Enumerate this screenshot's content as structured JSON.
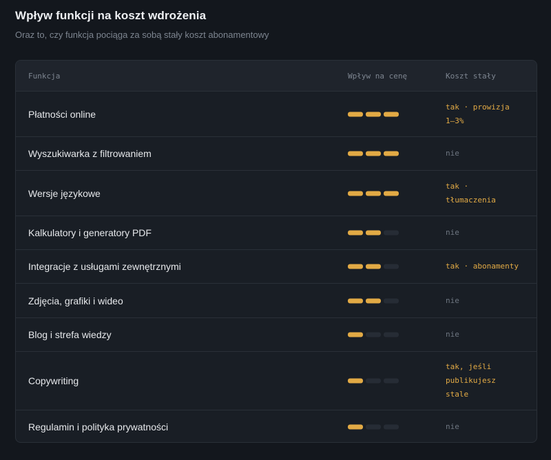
{
  "title": "Wpływ funkcji na koszt wdrożenia",
  "subtitle": "Oraz to, czy funkcja pociąga za sobą stały koszt abonamentowy",
  "table": {
    "headers": {
      "feature": "Funkcja",
      "impact": "Wpływ na cenę",
      "cost": "Koszt stały"
    },
    "max_level": 3,
    "rows": [
      {
        "feature": "Płatności online",
        "level": 3,
        "cost_line1": "tak · prowizja",
        "cost_line2": "1–3%",
        "cost_line3": "",
        "recurring": true
      },
      {
        "feature": "Wyszukiwarka z filtrowaniem",
        "level": 3,
        "cost_line1": "nie",
        "cost_line2": "",
        "cost_line3": "",
        "recurring": false
      },
      {
        "feature": "Wersje językowe",
        "level": 3,
        "cost_line1": "tak ·",
        "cost_line2": "tłumaczenia",
        "cost_line3": "",
        "recurring": true
      },
      {
        "feature": "Kalkulatory i generatory PDF",
        "level": 2,
        "cost_line1": "nie",
        "cost_line2": "",
        "cost_line3": "",
        "recurring": false
      },
      {
        "feature": "Integracje z usługami zewnętrznymi",
        "level": 2,
        "cost_line1": "tak · abonamenty",
        "cost_line2": "",
        "cost_line3": "",
        "recurring": true
      },
      {
        "feature": "Zdjęcia, grafiki i wideo",
        "level": 2,
        "cost_line1": "nie",
        "cost_line2": "",
        "cost_line3": "",
        "recurring": false
      },
      {
        "feature": "Blog i strefa wiedzy",
        "level": 1,
        "cost_line1": "nie",
        "cost_line2": "",
        "cost_line3": "",
        "recurring": false
      },
      {
        "feature": "Copywriting",
        "level": 1,
        "cost_line1": "tak, jeśli",
        "cost_line2": "publikujesz",
        "cost_line3": "stale",
        "recurring": true
      },
      {
        "feature": "Regulamin i polityka prywatności",
        "level": 1,
        "cost_line1": "nie",
        "cost_line2": "",
        "cost_line3": "",
        "recurring": false
      }
    ]
  },
  "colors": {
    "accent": "#e2aa45",
    "background": "#13171d",
    "card": "#191e25",
    "muted": "#6e7681"
  }
}
